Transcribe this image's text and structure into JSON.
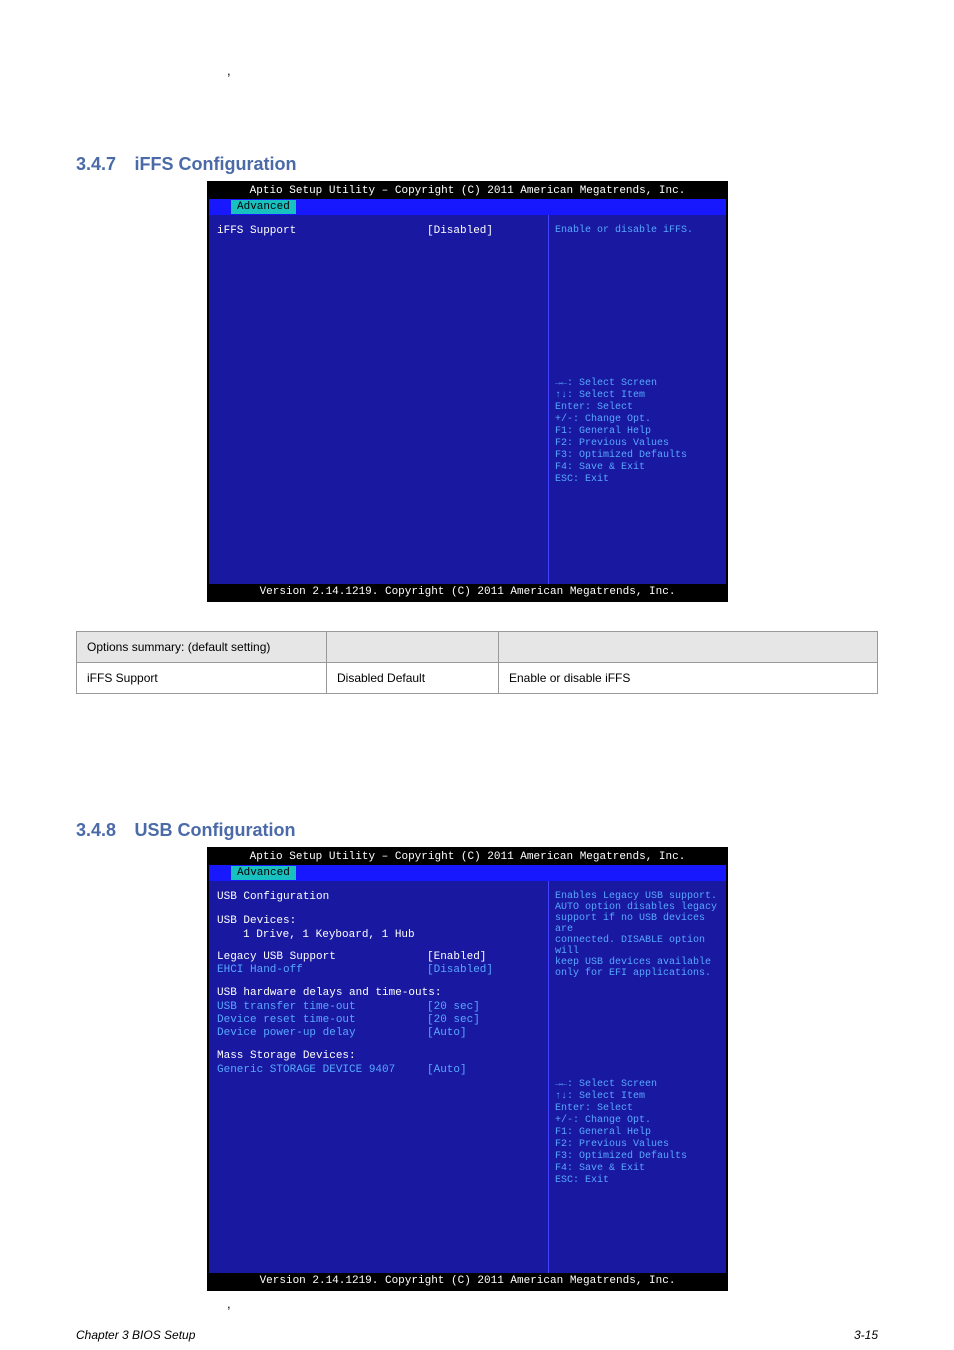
{
  "apostrophe": ",",
  "section1": {
    "label_num": "3.4.7",
    "label_text": "iFFS Configuration"
  },
  "bios1": {
    "topbar": "Aptio Setup Utility – Copyright (C) 2011 American Megatrends, Inc.",
    "tab": "Advanced",
    "left_label": "iFFS Support",
    "left_value": "[Disabled]",
    "right_desc": "Enable or disable iFFS.",
    "help": {
      "l1": "→←: Select Screen",
      "l2": "↑↓: Select Item",
      "l3": "Enter: Select",
      "l4": "+/-: Change Opt.",
      "l5": "F1: General Help",
      "l6": "F2: Previous Values",
      "l7": "F3: Optimized Defaults",
      "l8": "F4: Save & Exit",
      "l9": "ESC: Exit"
    },
    "bottom": "Version 2.14.1219. Copyright (C) 2011 American Megatrends, Inc."
  },
  "table1": {
    "h1": "Options summary: (default setting)",
    "h2": "",
    "h3": "",
    "r1c1": "iFFS Support",
    "r1c2": "Disabled    Default",
    "r1c3": "Enable or disable iFFS"
  },
  "section2": {
    "label_num": "3.4.8",
    "label_text": "USB Configuration"
  },
  "bios2": {
    "topbar": "Aptio Setup Utility – Copyright (C) 2011 American Megatrends, Inc.",
    "tab": "Advanced",
    "heading1": "USB Configuration",
    "heading2": "USB Devices:",
    "devices": "1 Drive, 1 Keyboard, 1 Hub",
    "row1_label": "Legacy USB Support",
    "row1_value": "[Enabled]",
    "row2_label": "EHCI Hand-off",
    "row2_value": "[Disabled]",
    "heading3": "USB hardware delays and time-outs:",
    "row3_label": "USB transfer time-out",
    "row3_value": "[20 sec]",
    "row4_label": "Device reset time-out",
    "row4_value": "[20 sec]",
    "row5_label": "Device power-up delay",
    "row5_value": "[Auto]",
    "heading4": "Mass Storage Devices:",
    "row6_label": "Generic STORAGE DEVICE 9407",
    "row6_value": "[Auto]",
    "right_desc1": "Enables Legacy USB support.",
    "right_desc2": "AUTO option disables legacy",
    "right_desc3": "support if no USB devices are",
    "right_desc4": "connected. DISABLE option will",
    "right_desc5": "keep USB devices available",
    "right_desc6": "only for EFI applications.",
    "help": {
      "l1": "→←: Select Screen",
      "l2": "↑↓: Select Item",
      "l3": "Enter: Select",
      "l4": "+/-: Change Opt.",
      "l5": "F1: General Help",
      "l6": "F2: Previous Values",
      "l7": "F3: Optimized Defaults",
      "l8": "F4: Save & Exit",
      "l9": "ESC: Exit"
    },
    "bottom": "Version 2.14.1219. Copyright (C) 2011 American Megatrends, Inc."
  },
  "footer": {
    "chapter": "Chapter 3 BIOS Setup",
    "page": "3-15"
  }
}
